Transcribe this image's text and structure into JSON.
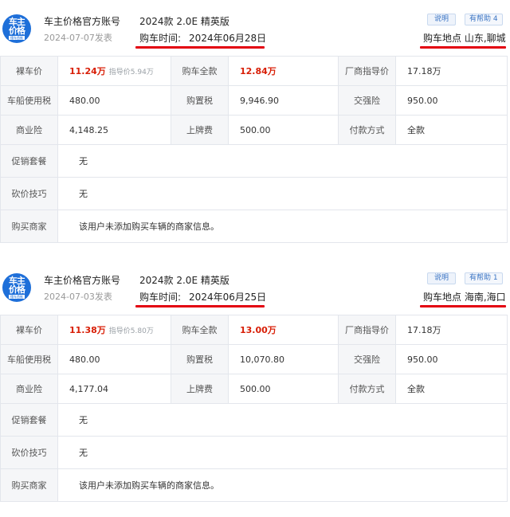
{
  "logo": {
    "line1": "车主",
    "line2": "价格",
    "line3": "懂车首推"
  },
  "cards": [
    {
      "account": "车主价格官方账号",
      "date": "2024-07-07发表",
      "model": "2024款 2.0E 精英版",
      "buy_time_label": "购车时间:",
      "buy_time_value": "2024年06月28日",
      "note_button": "说明",
      "help_button": "有帮助 4",
      "location": "购车地点 山东,聊城",
      "bare_price_label": "裸车价",
      "bare_price_value": "11.24万",
      "guide_note": "指导价5.94万",
      "total_label": "购车全款",
      "total_value": "12.84万",
      "msrp_label": "厂商指导价",
      "msrp_value": "17.18万",
      "vehicle_tax_label": "车船使用税",
      "vehicle_tax_value": "480.00",
      "purchase_tax_label": "购置税",
      "purchase_tax_value": "9,946.90",
      "compulsory_label": "交强险",
      "compulsory_value": "950.00",
      "commercial_label": "商业险",
      "commercial_value": "4,148.25",
      "plate_label": "上牌费",
      "plate_value": "500.00",
      "payment_label": "付款方式",
      "payment_value": "全款",
      "promo_label": "促销套餐",
      "promo_value": "无",
      "bargain_label": "砍价技巧",
      "bargain_value": "无",
      "dealer_label": "购买商家",
      "dealer_value": "该用户未添加购买车辆的商家信息。"
    },
    {
      "account": "车主价格官方账号",
      "date": "2024-07-03发表",
      "model": "2024款 2.0E 精英版",
      "buy_time_label": "购车时间:",
      "buy_time_value": "2024年06月25日",
      "note_button": "说明",
      "help_button": "有帮助 1",
      "location": "购车地点 海南,海口",
      "bare_price_label": "裸车价",
      "bare_price_value": "11.38万",
      "guide_note": "指导价5.80万",
      "total_label": "购车全款",
      "total_value": "13.00万",
      "msrp_label": "厂商指导价",
      "msrp_value": "17.18万",
      "vehicle_tax_label": "车船使用税",
      "vehicle_tax_value": "480.00",
      "purchase_tax_label": "购置税",
      "purchase_tax_value": "10,070.80",
      "compulsory_label": "交强险",
      "compulsory_value": "950.00",
      "commercial_label": "商业险",
      "commercial_value": "4,177.04",
      "plate_label": "上牌费",
      "plate_value": "500.00",
      "payment_label": "付款方式",
      "payment_value": "全款",
      "promo_label": "促销套餐",
      "promo_value": "无",
      "bargain_label": "砍价技巧",
      "bargain_value": "无",
      "dealer_label": "购买商家",
      "dealer_value": "该用户未添加购买车辆的商家信息。"
    }
  ],
  "colors": {
    "accent_red": "#d81e06",
    "underline_red": "#e3000f",
    "brand_blue": "#1e6fd9"
  }
}
